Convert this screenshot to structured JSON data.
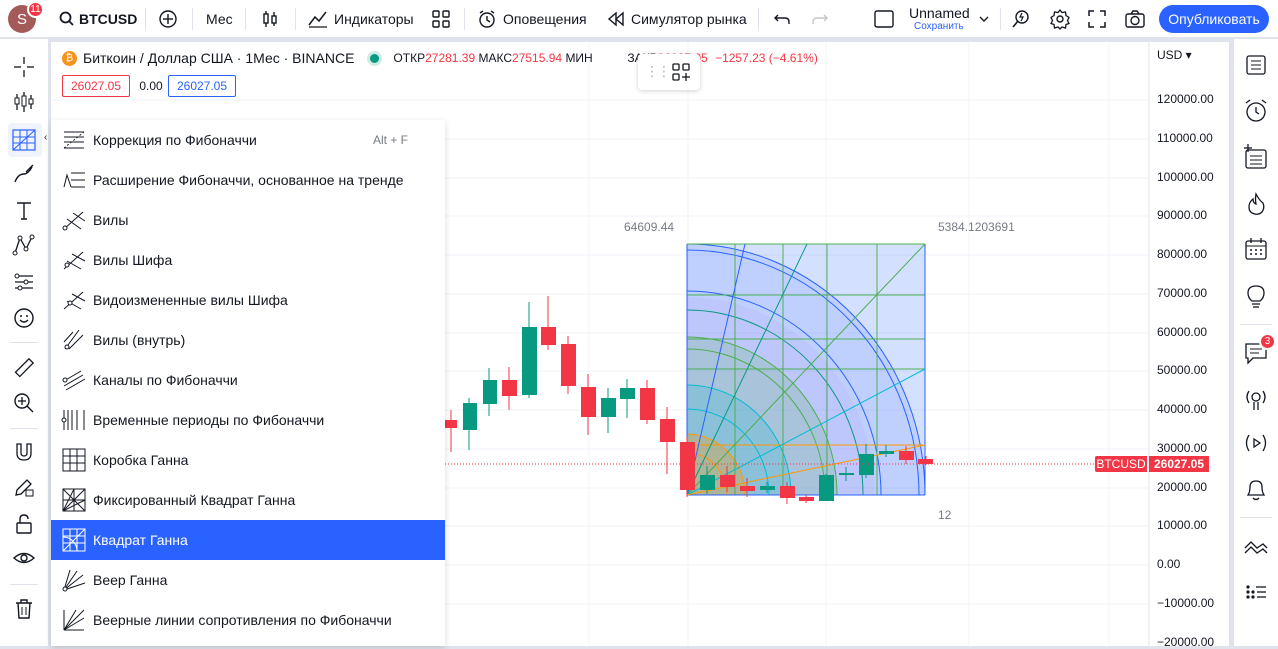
{
  "topbar": {
    "avatar_letter": "S",
    "avatar_badge": "11",
    "symbol": "BTCUSD",
    "interval": "Мес",
    "indicators_label": "Индикаторы",
    "alerts_label": "Оповещения",
    "replay_label": "Симулятор рынка",
    "layout_name": "Unnamed",
    "layout_save": "Сохранить",
    "publish_label": "Опубликовать"
  },
  "legend": {
    "title": "Биткоин / Доллар США · 1Мес · BINANCE",
    "open_label": "ОТКР",
    "open_value": "27281.39",
    "high_label": "МАКС",
    "high_value": "27515.94",
    "low_label": "МИН",
    "close_label": "ЗАКР",
    "close_value": "26027.05",
    "change": "−1257.23 (−4.61%)",
    "bid": "26027.05",
    "spread": "0.00",
    "ask": "26027.05"
  },
  "currency": "USD",
  "price_axis": [
    "120000.00",
    "110000.00",
    "100000.00",
    "90000.00",
    "80000.00",
    "70000.00",
    "60000.00",
    "50000.00",
    "40000.00",
    "30000.00",
    "20000.00",
    "10000.00",
    "0.00",
    "−10000.00",
    "−20000.00"
  ],
  "symbol_tag": "BTCUSD",
  "symbol_price": "26027.05",
  "gann": {
    "top_left_label": "64609.44",
    "top_right_label": "5384.1203691",
    "bottom_right_label": "12"
  },
  "right_badge": "3",
  "menu": {
    "items": [
      {
        "label": "Коррекция по Фибоначчи",
        "shortcut": "Alt + F"
      },
      {
        "label": "Расширение Фибоначчи, основанное на тренде"
      },
      {
        "label": "Вилы"
      },
      {
        "label": "Вилы Шифа"
      },
      {
        "label": "Видоизмененные вилы Шифа"
      },
      {
        "label": "Вилы (внутрь)"
      },
      {
        "label": "Каналы по Фибоначчи"
      },
      {
        "label": "Временные периоды по Фибоначчи"
      },
      {
        "label": "Коробка Ганна"
      },
      {
        "label": "Фиксированный Квадрат Ганна"
      },
      {
        "label": "Квадрат Ганна",
        "active": true
      },
      {
        "label": "Веер Ганна"
      },
      {
        "label": "Веерные линии сопротивления по Фибоначчи"
      }
    ]
  },
  "colors": {
    "accent": "#2962ff",
    "up": "#26a69a",
    "down": "#f23645"
  }
}
